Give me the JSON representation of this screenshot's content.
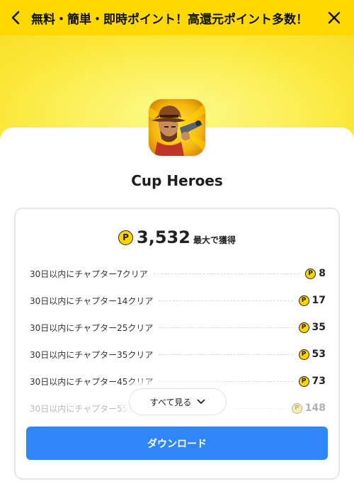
{
  "header": {
    "title": "無料・簡単・即時ポイント！高還元ポイント多数！",
    "back_icon": "chevron-left-icon",
    "close_icon": "close-icon",
    "background_color": "#ffd800"
  },
  "app": {
    "name": "Cup Heroes",
    "icon": "cowboy-gunslinger-app-icon"
  },
  "reward": {
    "coin_symbol": "P",
    "total_value": "3,532",
    "total_suffix": "最大で獲得"
  },
  "tasks": [
    {
      "label": "30日以内にチャプター7クリア",
      "points": "8"
    },
    {
      "label": "30日以内にチャプター14クリア",
      "points": "17"
    },
    {
      "label": "30日以内にチャプター25クリア",
      "points": "35"
    },
    {
      "label": "30日以内にチャプター35クリア",
      "points": "53"
    },
    {
      "label": "30日以内にチャプター45クリア",
      "points": "73"
    },
    {
      "label": "30日以内にチャプター55クリア",
      "points": "148"
    }
  ],
  "see_all": {
    "label": "すべて見る",
    "icon": "chevron-down-icon"
  },
  "download": {
    "label": "ダウンロード",
    "color": "#2f86f6"
  }
}
